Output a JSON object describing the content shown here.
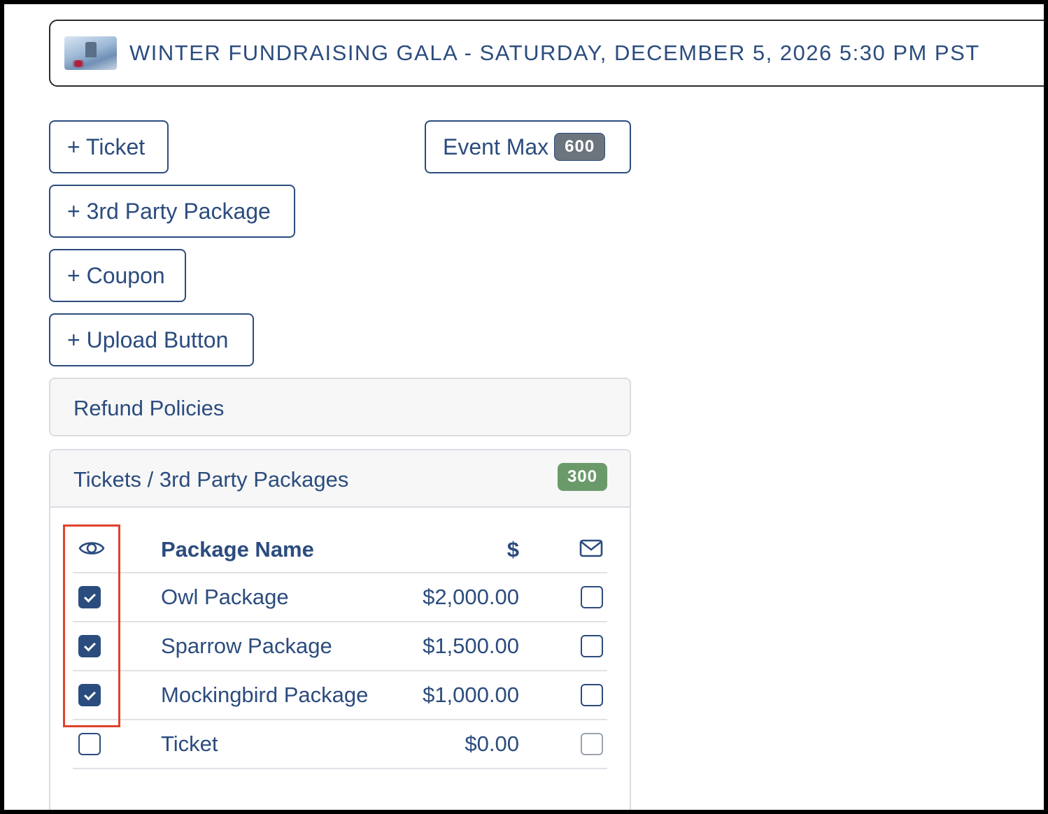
{
  "event": {
    "title": "WINTER FUNDRAISING GALA - SATURDAY, DECEMBER 5, 2026 5:30 PM PST"
  },
  "buttons": {
    "add_ticket": "+ Ticket",
    "add_3rd_party": "+ 3rd Party Package",
    "add_coupon": "+ Coupon",
    "add_upload": "+ Upload Button",
    "event_max_label": "Event Max",
    "event_max_value": "600"
  },
  "refund": {
    "title": "Refund Policies"
  },
  "tickets": {
    "title": "Tickets / 3rd Party Packages",
    "count": "300",
    "columns": {
      "visibility_icon": "eye-icon",
      "name": "Package Name",
      "price": "$",
      "email_icon": "envelope-icon"
    },
    "rows": [
      {
        "visible": true,
        "name": "Owl Package",
        "price": "$2,000.00",
        "email": false
      },
      {
        "visible": true,
        "name": "Sparrow Package",
        "price": "$1,500.00",
        "email": false
      },
      {
        "visible": true,
        "name": "Mockingbird Package",
        "price": "$1,000.00",
        "email": false
      },
      {
        "visible": false,
        "name": "Ticket",
        "price": "$0.00",
        "email": false
      }
    ]
  },
  "colors": {
    "primary": "#2b4c7e",
    "badge_gray": "#6c757d",
    "badge_green": "#6b9a6a",
    "highlight": "#e0422c"
  }
}
